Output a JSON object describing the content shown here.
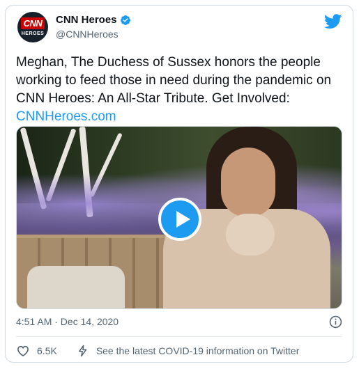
{
  "account": {
    "display_name": "CNN Heroes",
    "handle": "@CNNHeroes",
    "avatar_logo_text": "CNN",
    "avatar_sub_text": "HEROES"
  },
  "tweet": {
    "text": "Meghan, The Duchess of Sussex honors the people working to feed those in need during the pandemic on CNN Heroes: An All-Star Tribute. Get Involved: ",
    "link": "CNNHeroes.com",
    "timestamp": "4:51 AM · Dec 14, 2020"
  },
  "actions": {
    "like_count": "6.5K",
    "covid_info": "See the latest COVID-19 information on Twitter"
  },
  "colors": {
    "accent": "#1d9bf0",
    "brand_red": "#cc0000",
    "text_secondary": "#536471"
  },
  "icons": [
    "verified-icon",
    "twitter-bird-icon",
    "play-icon",
    "info-icon",
    "heart-icon",
    "bolt-icon"
  ]
}
